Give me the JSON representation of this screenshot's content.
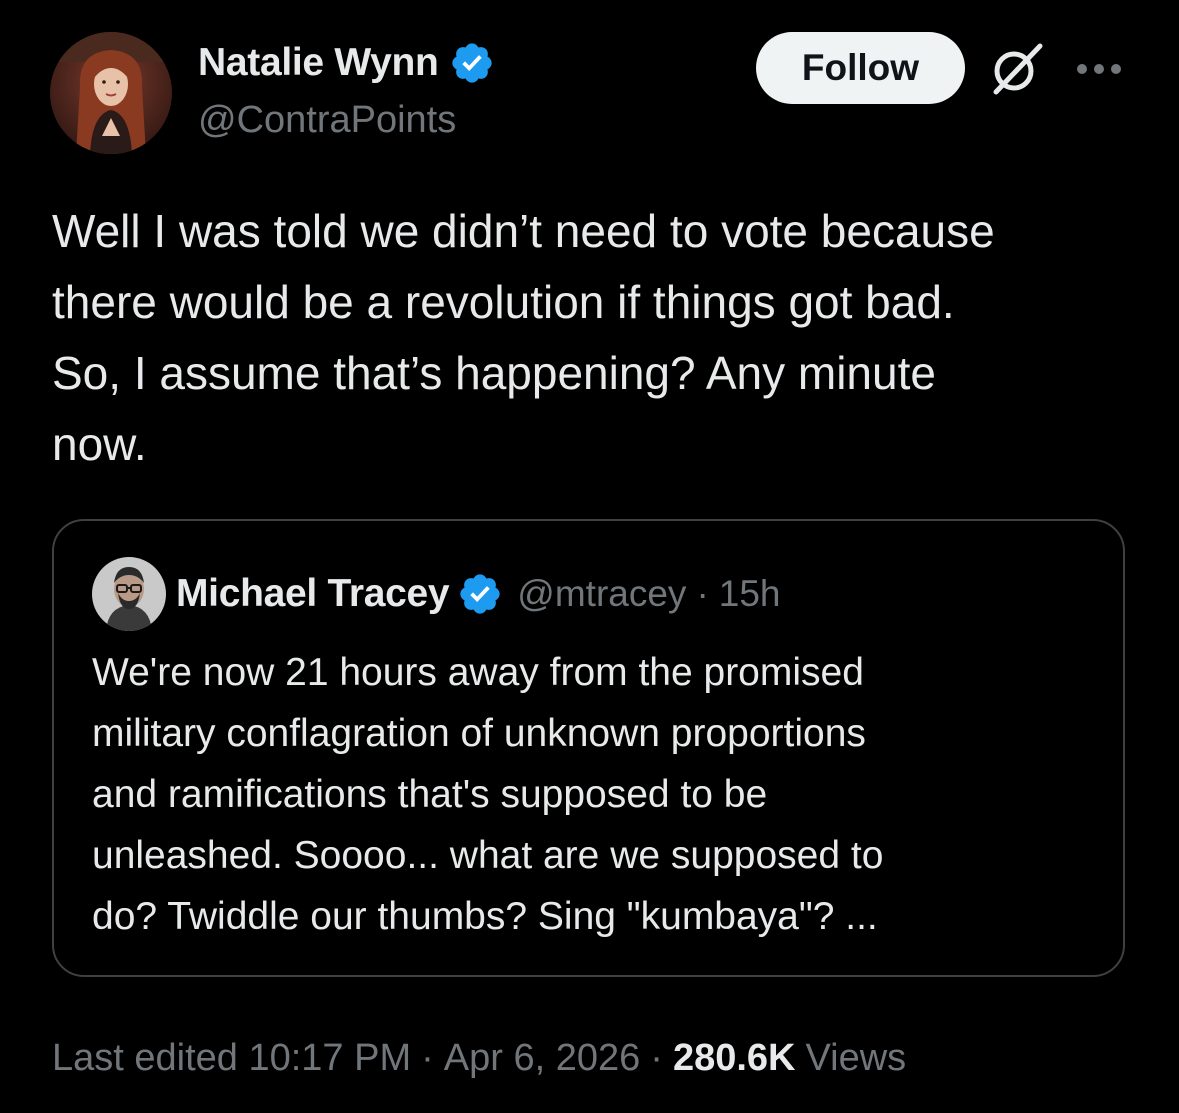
{
  "colors": {
    "background": "#000000",
    "primary_text": "#e7e9ea",
    "secondary_text": "#71767b",
    "verified_badge": "#1d9bf0",
    "follow_button_bg": "#eff3f4",
    "card_border": "#3e4144"
  },
  "tweet": {
    "author": {
      "name": "Natalie Wynn",
      "handle": "@ContraPoints",
      "verified_icon": "verified-badge-icon",
      "avatar": "avatar-photo"
    },
    "follow_label": "Follow",
    "grok_icon": "grok-icon",
    "more_icon": "more-options-icon",
    "text_lines": [
      "Well I was told we didn’t need to vote because",
      "there would be a revolution if things got bad.",
      "So, I assume that’s happening? Any minute",
      "now."
    ],
    "quote": {
      "author_name": "Michael Tracey",
      "handle": "@mtracey",
      "separator": "·",
      "time": "15h",
      "verified_icon": "verified-badge-icon",
      "text_lines": [
        "We're now 21 hours away from the promised",
        "military conflagration of unknown proportions",
        "and ramifications that's supposed to be",
        "unleashed. Soooo... what are we supposed to",
        "do? Twiddle our thumbs? Sing \"kumbaya\"? ..."
      ]
    },
    "meta": {
      "edited_label": "Last edited 10:17 PM",
      "separator": "·",
      "date": "Apr 6, 2026",
      "views_count": "280.6K",
      "views_label": "Views"
    }
  }
}
